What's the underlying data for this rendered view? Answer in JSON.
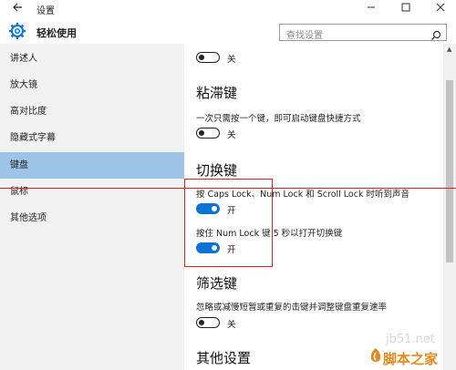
{
  "window": {
    "title": "设置",
    "back_icon": "back-arrow-icon",
    "min_icon": "minimize-icon",
    "max_icon": "maximize-icon",
    "close_icon": "close-icon"
  },
  "header": {
    "app_title": "轻松使用",
    "app_icon": "gear-icon",
    "search_placeholder": "查找设置",
    "search_icon": "search-icon"
  },
  "sidebar": {
    "items": [
      {
        "label": "讲述人",
        "active": false
      },
      {
        "label": "放大镜",
        "active": false
      },
      {
        "label": "高对比度",
        "active": false
      },
      {
        "label": "隐藏式字幕",
        "active": false
      },
      {
        "label": "键盘",
        "active": true
      },
      {
        "label": "鼠标",
        "active": false
      },
      {
        "label": "其他选项",
        "active": false
      }
    ]
  },
  "content": {
    "top_toggle": {
      "state": "off",
      "label": "关"
    },
    "sticky": {
      "heading": "粘滞键",
      "description": "一次只需按一个键，即可启动键盘快捷方式",
      "toggle": {
        "state": "off",
        "label": "关"
      }
    },
    "toggle_keys": {
      "heading": "切换键",
      "desc1": "按 Caps Lock、Num Lock 和 Scroll Lock 时听到声音",
      "toggle1": {
        "state": "on",
        "label": "开"
      },
      "desc2": "按住 Num Lock 键 5 秒以打开切换键",
      "toggle2": {
        "state": "on",
        "label": "开"
      }
    },
    "filter": {
      "heading": "筛选键",
      "description": "忽略或减慢短暂或重复的击键并调整键盘重复速率",
      "toggle": {
        "state": "off",
        "label": "关"
      }
    },
    "other": {
      "heading": "其他设置"
    }
  },
  "watermark": {
    "site": "jb51.net",
    "name": "脚本之家"
  },
  "colors": {
    "accent": "#0a74d6",
    "active_nav": "#9dc3e6",
    "annotation": "#e02020",
    "sidebar_bg": "#f2f2f2"
  }
}
